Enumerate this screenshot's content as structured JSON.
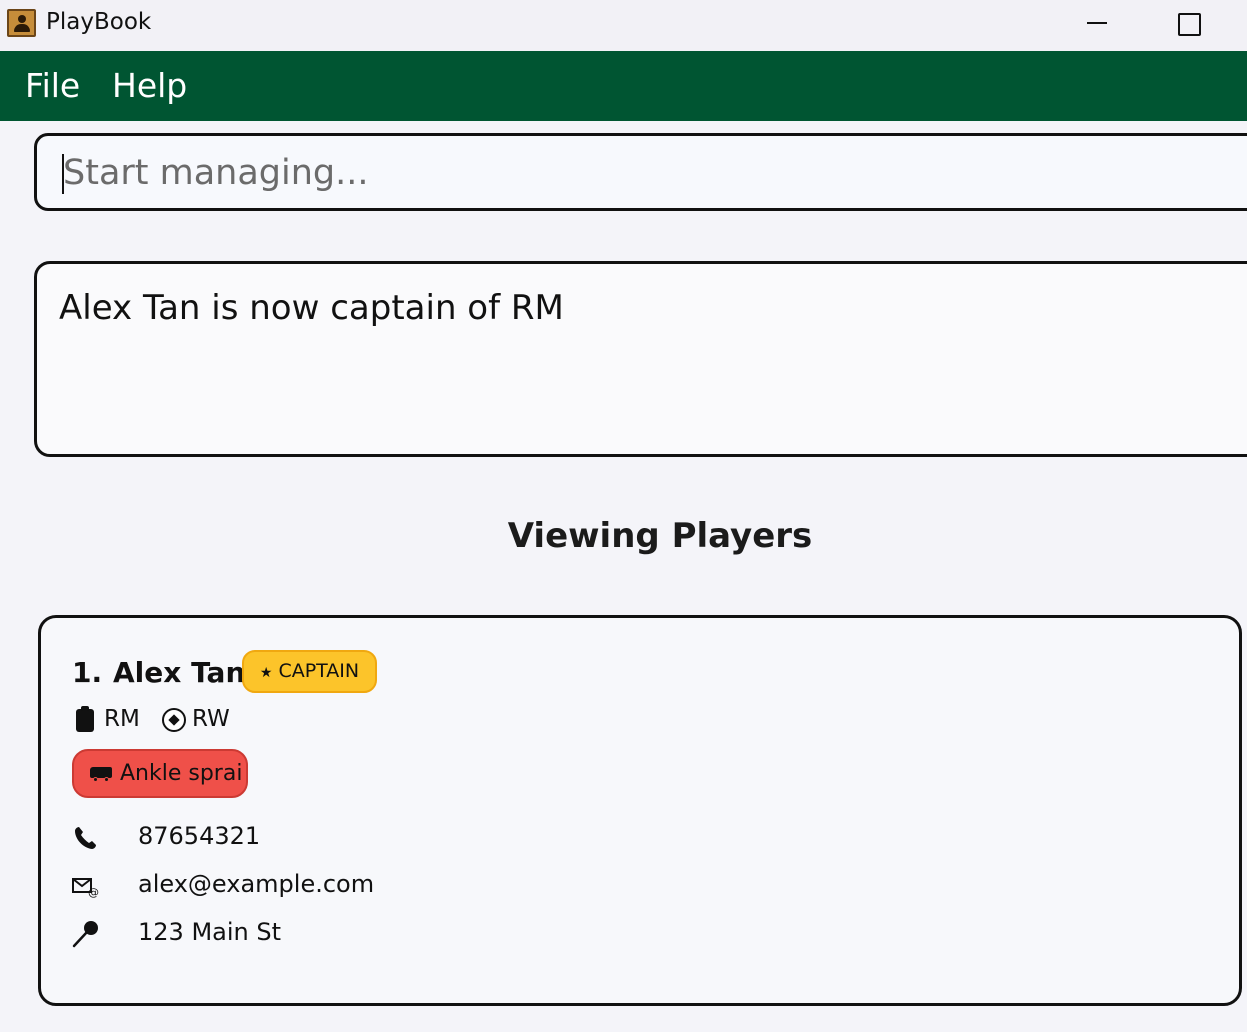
{
  "window": {
    "title": "PlayBook",
    "icon": "address-book-icon"
  },
  "menu": {
    "file": "File",
    "help": "Help"
  },
  "command": {
    "placeholder": "Start managing..."
  },
  "result": {
    "message": "Alex Tan is now captain of RM"
  },
  "list": {
    "heading": "Viewing Players",
    "players": [
      {
        "index": "1.",
        "name": "Alex Tan",
        "captain_label": "CAPTAIN",
        "captain_icon": "star-icon",
        "positions": [
          {
            "label": "RM",
            "icon": "clipboard-icon"
          },
          {
            "label": "RW",
            "icon": "soccer-ball-icon"
          }
        ],
        "injury": {
          "label": "Ankle sprai",
          "icon": "ambulance-icon",
          "color": "#ef5049"
        },
        "phone": "87654321",
        "email": "alex@example.com",
        "address": "123 Main St"
      }
    ]
  },
  "colors": {
    "menubar": "#005532",
    "captain_badge": "#fcc42a",
    "injury_badge": "#ef5049",
    "background": "#f4f4f9"
  }
}
